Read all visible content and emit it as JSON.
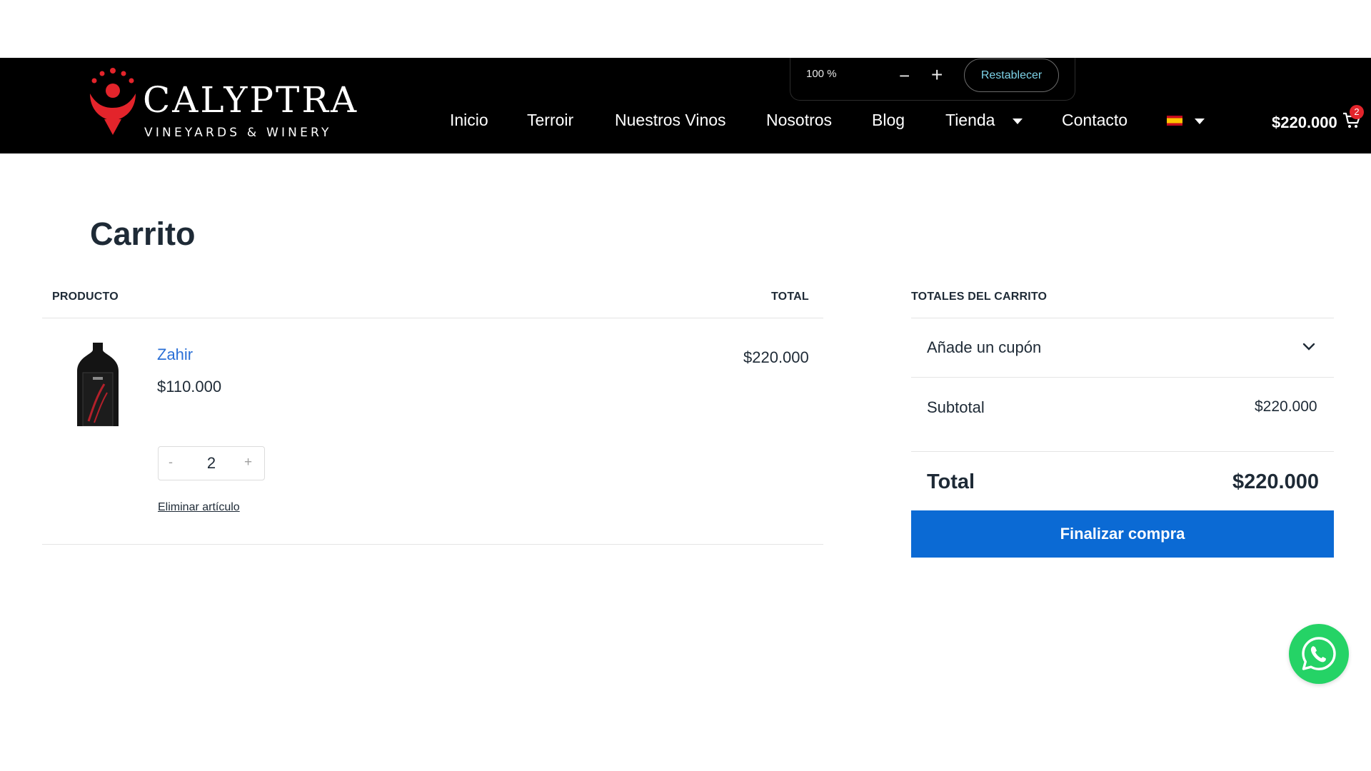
{
  "logo": {
    "name": "CALYPTRA",
    "tagline": "VINEYARDS & WINERY",
    "accent": "#e3242b"
  },
  "zoom": {
    "level": "100 %",
    "minus": "−",
    "plus": "+",
    "reset": "Restablecer"
  },
  "nav": {
    "items": [
      "Inicio",
      "Terroir",
      "Nuestros Vinos",
      "Nosotros",
      "Blog",
      "Tienda",
      "Contacto"
    ],
    "language_flag": "spain-flag-icon"
  },
  "cart": {
    "amount": "$220.000",
    "count": "2",
    "icon": "cart-icon"
  },
  "page": {
    "title": "Carrito"
  },
  "table": {
    "headers": {
      "product": "PRODUCTO",
      "total": "TOTAL"
    },
    "item": {
      "name": "Zahir",
      "price": "$110.000",
      "quantity": "2",
      "qty_minus": "-",
      "qty_plus": "+",
      "line_total": "$220.000",
      "remove": "Eliminar artículo"
    }
  },
  "totals": {
    "heading": "TOTALES DEL CARRITO",
    "coupon": "Añade un cupón",
    "subtotal_label": "Subtotal",
    "subtotal_value": "$220.000",
    "total_label": "Total",
    "total_value": "$220.000",
    "checkout": "Finalizar compra"
  },
  "colors": {
    "header_bg": "#000000",
    "link": "#2a6fd6",
    "button": "#0b6ad4",
    "whatsapp": "#25d366"
  },
  "whatsapp": {
    "icon": "whatsapp-icon"
  }
}
